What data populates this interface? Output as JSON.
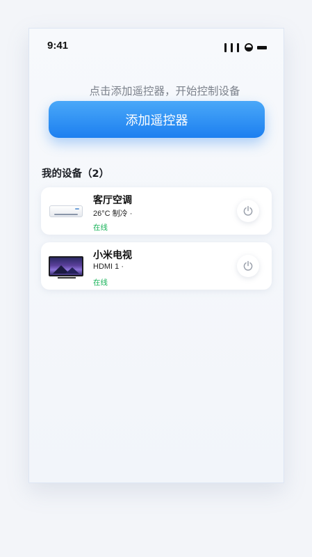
{
  "status_bar": {
    "time": "9:41"
  },
  "hint": "点击添加遥控器，开始控制设备",
  "add_button": {
    "label": "添加遥控器"
  },
  "devices_section": {
    "title": "我的设备（2）"
  },
  "devices": [
    {
      "name": "客厅空调",
      "state": "26°C 制冷 ·",
      "status": "在线",
      "icon": "air-conditioner-icon"
    },
    {
      "name": "小米电视",
      "state": "HDMI 1 ·",
      "status": "在线",
      "icon": "tv-icon"
    }
  ],
  "colors": {
    "accent": "#2a8cf4",
    "online": "#19b35a",
    "background": "#f3f5f9"
  }
}
